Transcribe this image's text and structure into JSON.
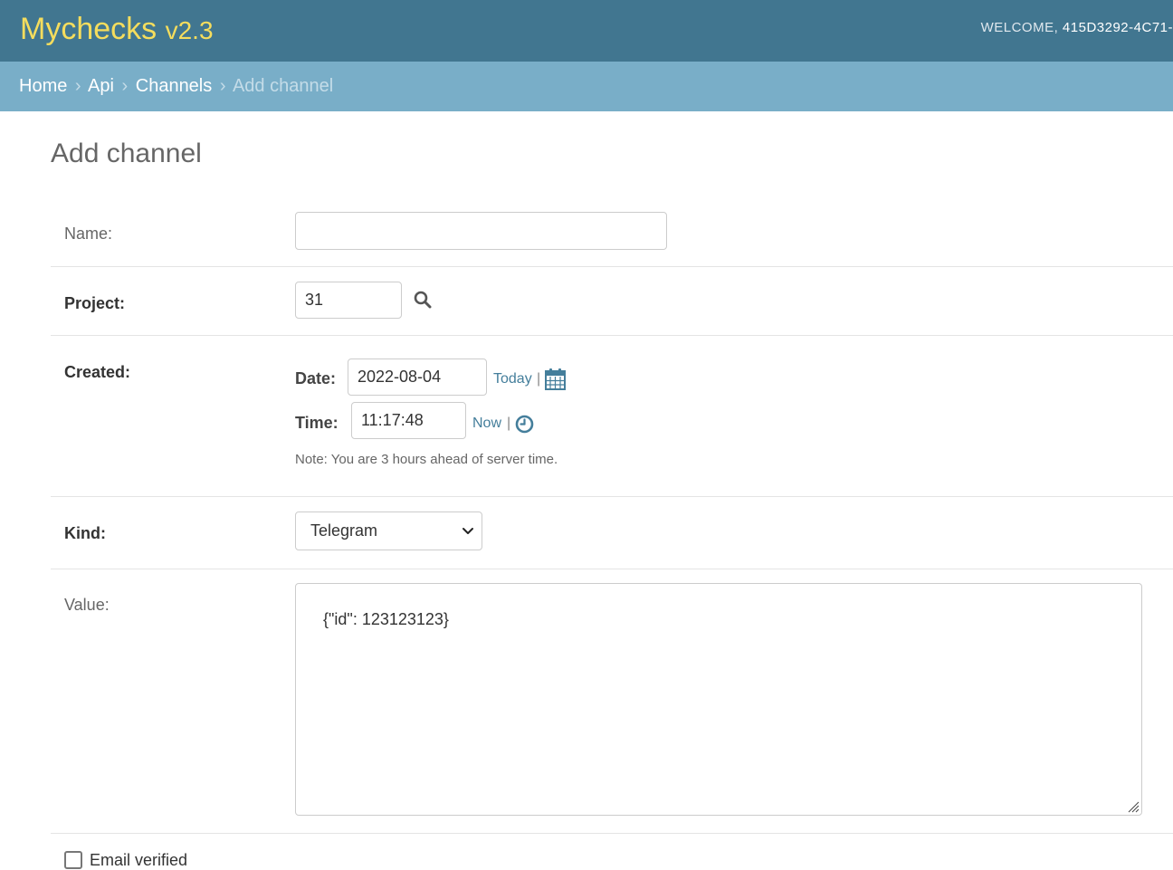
{
  "header": {
    "brand_name": "Mychecks",
    "brand_version": "v2.3",
    "welcome_label": "WELCOME,",
    "user_id": "415D3292-4C71-"
  },
  "breadcrumbs": {
    "items": [
      "Home",
      "Api",
      "Channels"
    ],
    "separator": "›",
    "current": "Add channel"
  },
  "page": {
    "title": "Add channel"
  },
  "form": {
    "name": {
      "label": "Name:",
      "value": ""
    },
    "project": {
      "label": "Project:",
      "value": "31",
      "lookup_icon": "search-icon"
    },
    "created": {
      "label": "Created:",
      "date_label": "Date:",
      "date_value": "2022-08-04",
      "today_link": "Today",
      "calendar_icon": "calendar-icon",
      "time_label": "Time:",
      "time_value": "11:17:48",
      "now_link": "Now",
      "clock_icon": "clock-icon",
      "pipe": "|",
      "timezone_note": "Note: You are 3 hours ahead of server time."
    },
    "kind": {
      "label": "Kind:",
      "selected": "Telegram",
      "dropdown_icon": "chevron-down-icon"
    },
    "value": {
      "label": "Value:",
      "text": "{\"id\": 123123123}"
    },
    "email_verified": {
      "label": "Email verified",
      "checked": false
    }
  },
  "colors": {
    "header_bg": "#417690",
    "brand": "#f5dd5d",
    "breadcrumb_bg": "#79aec8",
    "link": "#447e9b"
  }
}
